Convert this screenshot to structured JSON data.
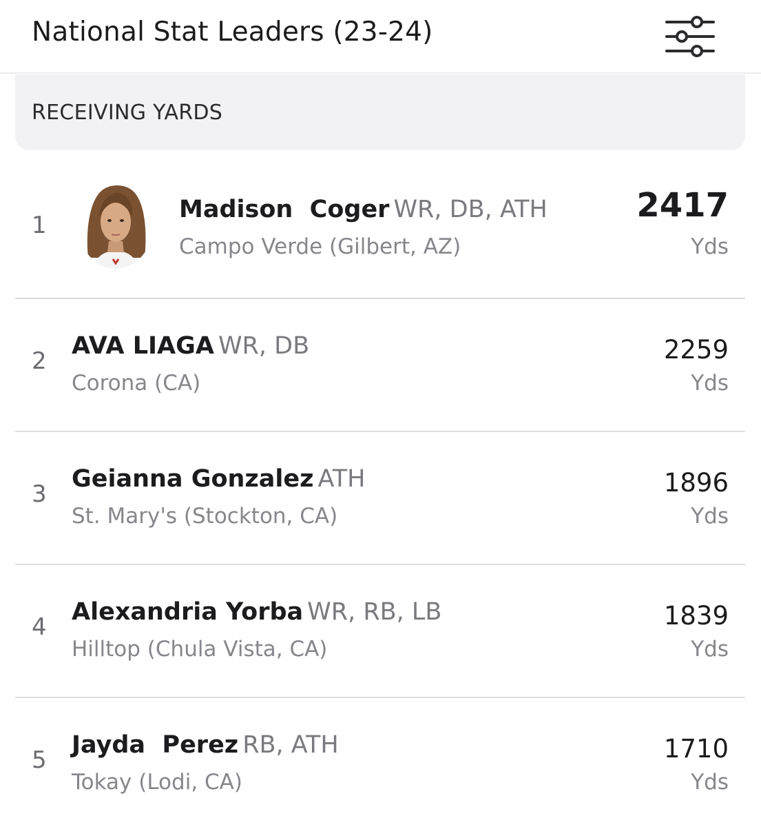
{
  "header": {
    "title": "National Stat Leaders (23-24)",
    "filter_icon": "sliders-icon"
  },
  "section": {
    "title": "RECEIVING YARDS"
  },
  "leaders": [
    {
      "rank": "1",
      "name": "Madison  Coger",
      "positions": "WR, DB, ATH",
      "school": "Campo Verde (Gilbert, AZ)",
      "value": "2417",
      "unit": "Yds"
    },
    {
      "rank": "2",
      "name": "AVA LIAGA",
      "positions": "WR, DB",
      "school": "Corona (CA)",
      "value": "2259",
      "unit": "Yds"
    },
    {
      "rank": "3",
      "name": "Geianna Gonzalez",
      "positions": "ATH",
      "school": "St. Mary's (Stockton, CA)",
      "value": "1896",
      "unit": "Yds"
    },
    {
      "rank": "4",
      "name": "Alexandria Yorba",
      "positions": "WR, RB, LB",
      "school": "Hilltop (Chula Vista, CA)",
      "value": "1839",
      "unit": "Yds"
    },
    {
      "rank": "5",
      "name": "Jayda  Perez",
      "positions": "RB, ATH",
      "school": "Tokay (Lodi, CA)",
      "value": "1710",
      "unit": "Yds"
    }
  ],
  "colors": {
    "text_primary": "#1c1c1e",
    "text_secondary": "#86868b",
    "section_bg": "#f2f2f4",
    "divider": "#dcdce0"
  }
}
